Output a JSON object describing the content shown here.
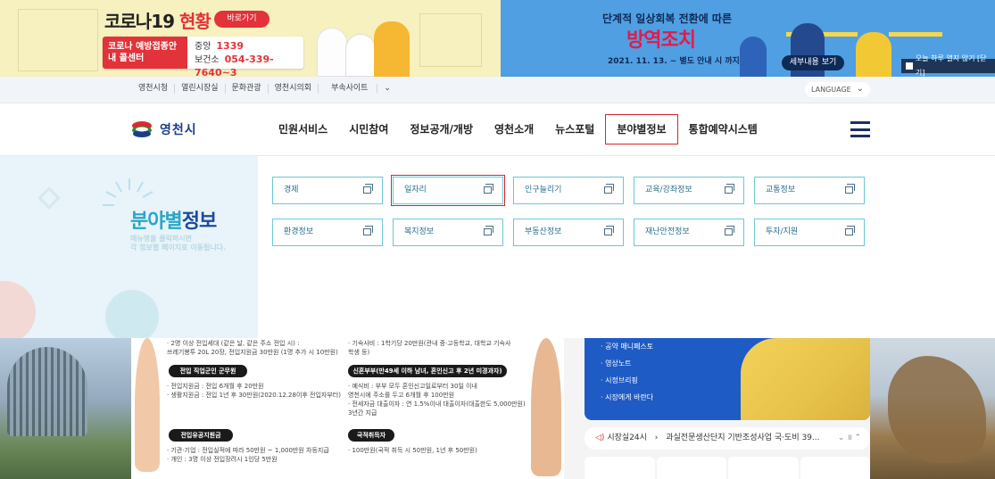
{
  "banner_left": {
    "title_main": "코로나19",
    "title_accent": "현황",
    "button": "바로가기",
    "center_label": "코로나 예방접종안내 콜센터",
    "rows": [
      {
        "label": "중앙",
        "number": "1339"
      },
      {
        "label": "보건소",
        "number": "054-339-7640~3"
      }
    ]
  },
  "banner_right": {
    "subtitle": "단계적 일상회복 전환에 따른",
    "title": "방역조치",
    "date": "2021. 11. 13. ~ 별도 안내 시 까지",
    "button": "세부내용 보기",
    "close_label": "오늘 하루 열지 않기 [닫기]"
  },
  "utility": {
    "links": [
      "영천시청",
      "열린시장실",
      "문화관광",
      "영천시의회",
      "부속사이트"
    ],
    "language": "LANGUAGE"
  },
  "nav": {
    "logo_text": "영천시",
    "menu": [
      "민원서비스",
      "시민참여",
      "정보공개/개방",
      "영천소개",
      "뉴스포털",
      "분야별정보",
      "통합예약시스템"
    ],
    "active_index": 5
  },
  "dropdown": {
    "title_a": "분야별",
    "title_b": "정보",
    "desc_line1": "메뉴명을 클릭하시면",
    "desc_line2": "각 정보별 페이지로 이동됩니다.",
    "items": [
      "경제",
      "일자리",
      "인구늘리기",
      "교육/강좌정보",
      "교통정보",
      "환경정보",
      "복지정보",
      "부동산정보",
      "재난안전정보",
      "투자/지원"
    ],
    "highlight_index": 1
  },
  "content": {
    "notice_left": {
      "lines_top": [
        "· 2명 이상 전입세대 (같은 날, 같은 주소 전입 시) :",
        "  쓰레기봉투 20L 20장, 전입지원금 30만원 (1명 추가 시 10만원)"
      ],
      "tag1": "전입 직업군인 군무원",
      "lines_mid": [
        "· 전입지원금 : 전입 6개월 후 20만원",
        "· 생활지원금 : 전입 1년 후 30만원(2020.12.28이후 전입자부터)"
      ],
      "tag2": "전입유공지원금",
      "lines_bot": [
        "· 기관·기업 : 전입실적에 따라 50만원 ~ 1,000만원 차등지급",
        "· 개인 : 3명 이상 전입장려시 1인당 5만원"
      ]
    },
    "notice_right": {
      "lines_top": [
        "· 기숙사비 : 1학기당 20만원(관내 중·고등학교, 대학교 기숙사",
        "  학생 등)"
      ],
      "tag1": "신혼부부(만49세 이하 남녀, 혼인신고 후 2년 미경과자)",
      "lines_mid": [
        "· 예식비 : 부부 모두 혼인신고일로부터 30일 이내",
        "  영천시에 주소를 두고 6개월 후 100만원",
        "· 전세자금 대출이자 : 연 1.5%이내 대출이자(대출한도 5,000만원)",
        "  3년간 지급"
      ],
      "tag2": "국적취득자",
      "lines_bot": [
        "· 100만원(국적 취득 시 50만원, 1년 후 50만원)"
      ]
    },
    "news_list": [
      "공약 매니페스토",
      "영상노트",
      "시정브리핑",
      "시장에게 바란다"
    ],
    "ticker_label": "시장실24시",
    "ticker_text": "과실전문생산단지 기반조성사업 국·도비 39..."
  }
}
